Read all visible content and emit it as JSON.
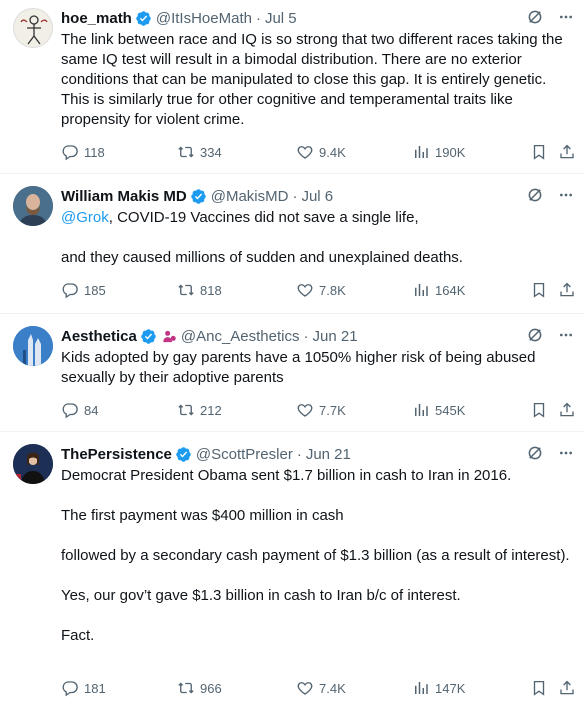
{
  "colors": {
    "verified": "#1d9bf0",
    "link": "#1d9bf0",
    "muted": "#536471",
    "text": "#0f1419"
  },
  "tweets": [
    {
      "name": "hoe_math",
      "handle": "@ItIsHoeMath",
      "sep": "·",
      "time": "Jul 5",
      "text": [
        "The link between race and IQ is so strong that two different races taking the same IQ test will result in a bimodal distribution. There are no exterior conditions that can be manipulated to close this gap. It is entirely genetic. This is similarly true for other cognitive and temperamental traits like propensity for violent crime."
      ],
      "replies": "118",
      "reposts": "334",
      "likes": "9.4K",
      "views": "190K"
    },
    {
      "name": "William Makis MD",
      "handle": "@MakisMD",
      "sep": "·",
      "time": "Jul 6",
      "mention": "@Grok",
      "text": [
        ", COVID-19 Vaccines did not save a single life,",
        "and they caused millions of sudden and unexplained deaths."
      ],
      "replies": "185",
      "reposts": "818",
      "likes": "7.8K",
      "views": "164K"
    },
    {
      "name": "Aesthetica",
      "handle": "@Anc_Aesthetics",
      "sep": "·",
      "time": "Jun 21",
      "text": [
        "Kids adopted by gay parents have a 1050% higher risk of being abused sexually by their adoptive parents"
      ],
      "replies": "84",
      "reposts": "212",
      "likes": "7.7K",
      "views": "545K"
    },
    {
      "name": "ThePersistence",
      "handle": "@ScottPresler",
      "sep": "·",
      "time": "Jun 21",
      "text": [
        "Democrat President Obama sent $1.7 billion in cash to Iran in 2016.",
        "The first payment was $400 million in cash",
        "followed by a secondary cash payment of $1.3 billion (as a result of interest).",
        "Yes, our gov’t gave $1.3 billion in cash to Iran b/c of interest.",
        "Fact."
      ],
      "replies": "181",
      "reposts": "966",
      "likes": "7.4K",
      "views": "147K"
    }
  ]
}
